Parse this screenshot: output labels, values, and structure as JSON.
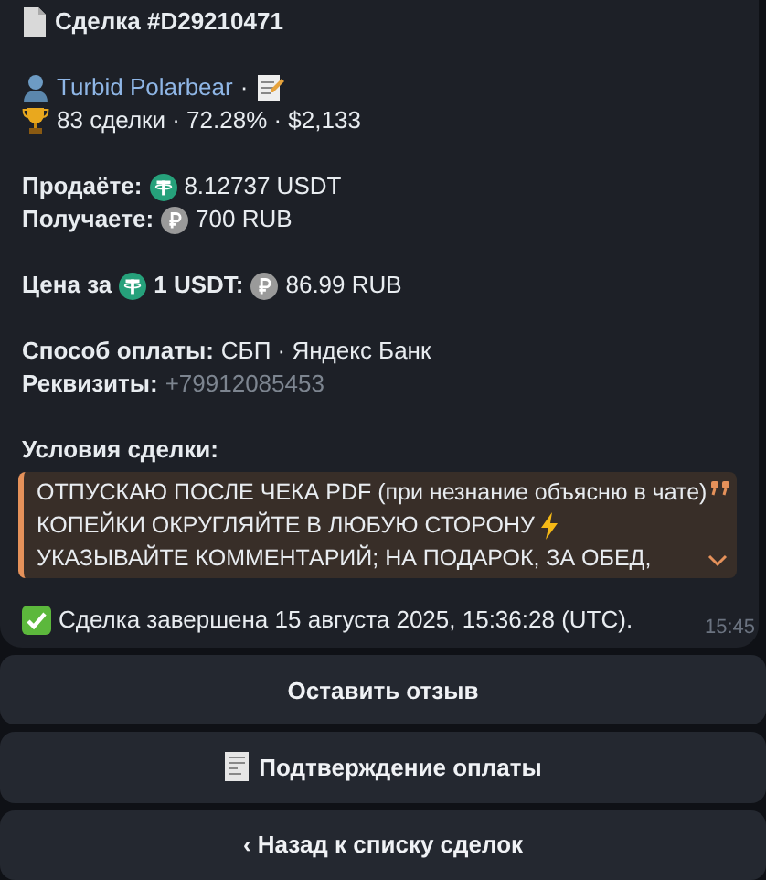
{
  "message": {
    "title": "Сделка #D29210471",
    "user": {
      "name": "Turbid Polarbear",
      "separator": "·"
    },
    "stats": "83 сделки · 72.28% · $2,133",
    "amounts": [
      {
        "label": "Продаёте:",
        "kind": "usdt",
        "value": "8.12737 USDT"
      },
      {
        "label": "Получаете:",
        "kind": "rub",
        "value": "700 RUB"
      }
    ],
    "price": {
      "label": "Цена за",
      "base": "1 USDT:",
      "value": "86.99 RUB"
    },
    "payment": {
      "label": "Способ оплаты:",
      "value": "СБП · Яндекс Банк"
    },
    "requisites": {
      "label": "Реквизиты:",
      "value": "+79912085453"
    },
    "terms": {
      "label": "Условия сделки:",
      "lines": [
        "ОТПУСКАЮ ПОСЛЕ ЧЕКА PDF (при незнание объясню в чате)",
        "КОПЕЙКИ ОКРУГЛЯЙТЕ В ЛЮБУЮ СТОРОНУ",
        "УКАЗЫВАЙТЕ КОММЕНТАРИЙ; НА ПОДАРОК, ЗА ОБЕД,"
      ]
    },
    "status": "Сделка завершена 15 августа 2025, 15:36:28 (UTC).",
    "time": "15:45"
  },
  "buttons": [
    {
      "label": "Оставить отзыв",
      "kind": "plain"
    },
    {
      "label": "Подтверждение оплаты",
      "kind": "receipt"
    },
    {
      "label": "‹ Назад к списку сделок",
      "kind": "plain"
    }
  ]
}
